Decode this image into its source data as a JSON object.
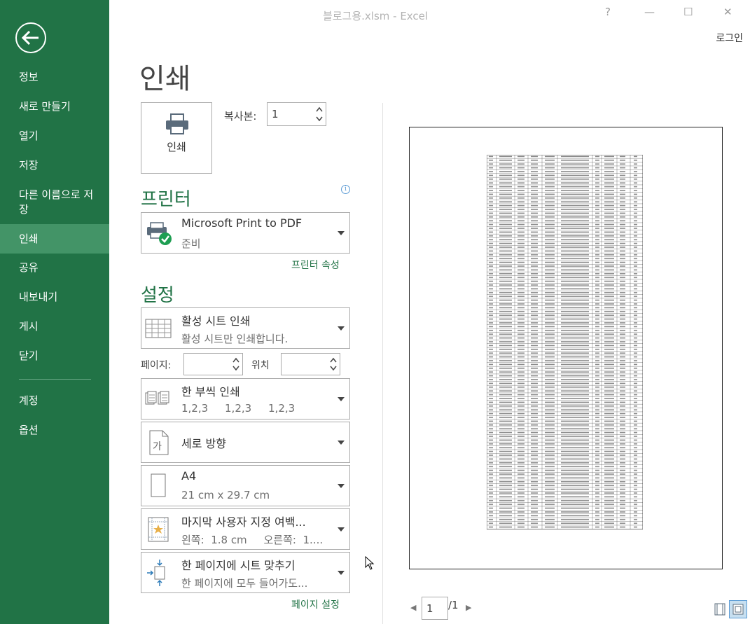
{
  "window": {
    "title": "블로그용.xlsm - Excel",
    "help": "?",
    "minimize": "—",
    "maximize": "☐",
    "close": "✕",
    "login": "로그인"
  },
  "sidebar": {
    "items": [
      {
        "label": "정보"
      },
      {
        "label": "새로 만들기"
      },
      {
        "label": "열기"
      },
      {
        "label": "저장"
      },
      {
        "label": "다른 이름으로 저장"
      },
      {
        "label": "인쇄",
        "active": true
      },
      {
        "label": "공유"
      },
      {
        "label": "내보내기"
      },
      {
        "label": "게시"
      },
      {
        "label": "닫기"
      },
      {
        "label": "계정"
      },
      {
        "label": "옵션"
      }
    ]
  },
  "print": {
    "title": "인쇄",
    "button_label": "인쇄",
    "copies_label": "복사본:",
    "copies_value": "1"
  },
  "printer": {
    "section_title": "프린터",
    "name": "Microsoft Print to PDF",
    "status": "준비",
    "properties_link": "프린터 속성"
  },
  "settings": {
    "section_title": "설정",
    "what": {
      "title": "활성 시트 인쇄",
      "subtitle": "활성 시트만 인쇄합니다."
    },
    "pages_label": "페이지:",
    "pages_value": "",
    "to_label": "위치",
    "to_value": "",
    "collate": {
      "title": "한 부씩 인쇄",
      "subtitle": "1,2,3     1,2,3     1,2,3"
    },
    "orientation": {
      "title": "세로 방향"
    },
    "paper": {
      "title": "A4",
      "subtitle": "21 cm x 29.7 cm"
    },
    "margins": {
      "title": "마지막 사용자 지정 여백...",
      "subtitle": "왼쪽:  1.8 cm     오른쪽:  1...."
    },
    "scaling": {
      "title": "한 페이지에 시트 맞추기",
      "subtitle": "한 페이지에 모두 들어가도..."
    },
    "page_setup_link": "페이지 설정"
  },
  "preview": {
    "current_page": "1",
    "total_pages": "/1",
    "prev": "◀",
    "next": "▶"
  }
}
